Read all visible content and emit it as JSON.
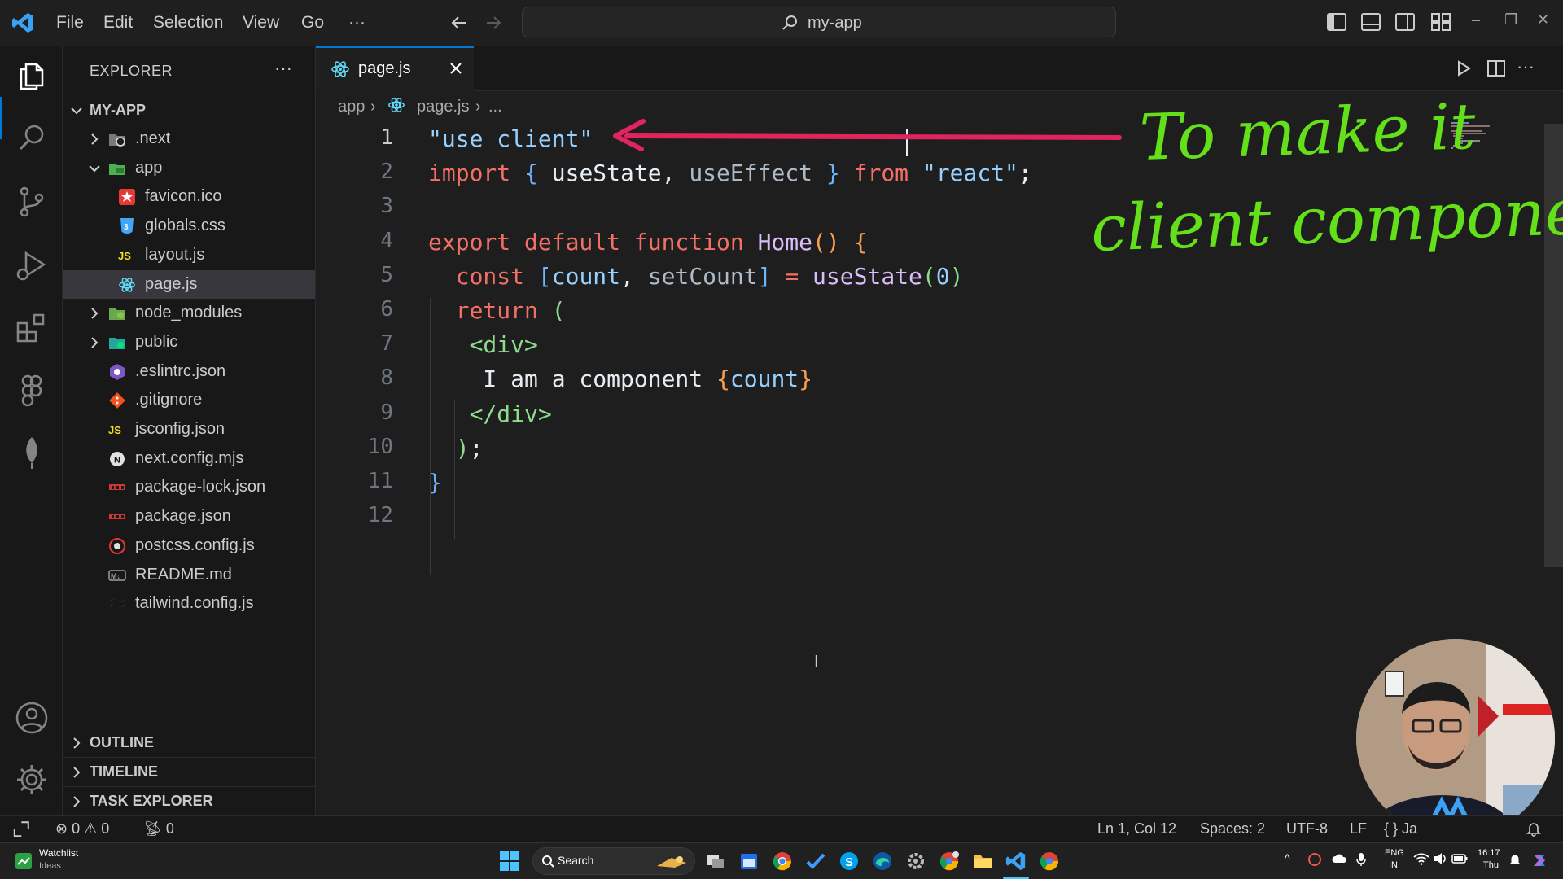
{
  "titlebar": {
    "menu": [
      "File",
      "Edit",
      "Selection",
      "View",
      "Go",
      "···"
    ],
    "search_text": "my-app",
    "window_controls": [
      "–",
      "❐",
      "✕"
    ]
  },
  "activitybar": {
    "icons": [
      "explorer-icon",
      "search-icon",
      "source-control-icon",
      "run-debug-icon",
      "extensions-icon",
      "git-graph-icon",
      "mongodb-leaf-icon",
      "accounts-icon",
      "settings-gear-icon"
    ]
  },
  "sidebar": {
    "title": "EXPLORER",
    "more": "···",
    "root": "MY-APP",
    "tree": [
      {
        "name": ".next",
        "depth": 1,
        "folder": true,
        "open": false,
        "icon": "next-folder-icon"
      },
      {
        "name": "app",
        "depth": 1,
        "folder": true,
        "open": true,
        "icon": "app-folder-icon"
      },
      {
        "name": "favicon.ico",
        "depth": 2,
        "icon": "favicon-icon"
      },
      {
        "name": "globals.css",
        "depth": 2,
        "icon": "css-file-icon"
      },
      {
        "name": "layout.js",
        "depth": 2,
        "icon": "js-file-icon"
      },
      {
        "name": "page.js",
        "depth": 2,
        "icon": "react-file-icon",
        "selected": true
      },
      {
        "name": "node_modules",
        "depth": 1,
        "folder": true,
        "open": false,
        "icon": "node-folder-icon"
      },
      {
        "name": "public",
        "depth": 1,
        "folder": true,
        "open": false,
        "icon": "public-folder-icon"
      },
      {
        "name": ".eslintrc.json",
        "depth": 1,
        "icon": "eslint-file-icon"
      },
      {
        "name": ".gitignore",
        "depth": 1,
        "icon": "git-file-icon"
      },
      {
        "name": "jsconfig.json",
        "depth": 1,
        "icon": "js-file-icon"
      },
      {
        "name": "next.config.mjs",
        "depth": 1,
        "icon": "next-file-icon"
      },
      {
        "name": "package-lock.json",
        "depth": 1,
        "icon": "npm-file-icon"
      },
      {
        "name": "package.json",
        "depth": 1,
        "icon": "npm-file-icon"
      },
      {
        "name": "postcss.config.js",
        "depth": 1,
        "icon": "postcss-file-icon"
      },
      {
        "name": "README.md",
        "depth": 1,
        "icon": "markdown-file-icon"
      },
      {
        "name": "tailwind.config.js",
        "depth": 1,
        "icon": "tailwind-file-icon"
      }
    ],
    "sections": [
      "OUTLINE",
      "TIMELINE",
      "TASK EXPLORER"
    ]
  },
  "editor": {
    "tab_label": "page.js",
    "breadcrumb": [
      "app",
      "page.js",
      "..."
    ],
    "lines": [
      [
        [
          "str",
          "\"use client\""
        ]
      ],
      [
        [
          "kw",
          "import "
        ],
        [
          "br2",
          "{ "
        ],
        [
          "plain",
          "useState"
        ],
        [
          "plain",
          ", "
        ],
        [
          "dim",
          "useEffect"
        ],
        [
          "br2",
          " }"
        ],
        [
          "kw",
          " from "
        ],
        [
          "str",
          "\"react\""
        ],
        [
          "plain",
          ";"
        ]
      ],
      [],
      [
        [
          "kw",
          "export default function "
        ],
        [
          "fn",
          "Home"
        ],
        [
          "br1",
          "() "
        ],
        [
          "br1",
          "{"
        ]
      ],
      [
        [
          "plain",
          "  "
        ],
        [
          "kw",
          "const "
        ],
        [
          "br2",
          "["
        ],
        [
          "var",
          "count"
        ],
        [
          "plain",
          ", "
        ],
        [
          "dim",
          "setCount"
        ],
        [
          "br2",
          "]"
        ],
        [
          "kw",
          " = "
        ],
        [
          "fn",
          "useState"
        ],
        [
          "br3",
          "("
        ],
        [
          "var",
          "0"
        ],
        [
          "br3",
          ")"
        ]
      ],
      [
        [
          "plain",
          "  "
        ],
        [
          "kw",
          "return "
        ],
        [
          "br3",
          "("
        ]
      ],
      [
        [
          "plain",
          "   "
        ],
        [
          "tag",
          "<div>"
        ]
      ],
      [
        [
          "plain",
          "    I am a component "
        ],
        [
          "br1",
          "{"
        ],
        [
          "var",
          "count"
        ],
        [
          "br1",
          "}"
        ]
      ],
      [
        [
          "plain",
          "   "
        ],
        [
          "tag",
          "</div>"
        ]
      ],
      [
        [
          "plain",
          "  "
        ],
        [
          "br3",
          ")"
        ],
        [
          "plain",
          ";"
        ]
      ],
      [
        [
          "br2",
          "}"
        ]
      ],
      []
    ],
    "current_line": 1,
    "mouse_cursor": "I"
  },
  "annotation": {
    "line1": "To make it",
    "line2": "client component",
    "color": "#63e01a",
    "arrow_color": "#e0245e"
  },
  "statusbar": {
    "errors": "0",
    "warnings": "0",
    "ports": "0",
    "position": "Ln 1, Col 12",
    "spaces": "Spaces: 2",
    "encoding": "UTF-8",
    "eol": "LF",
    "lang": "{ } Ja",
    "bell": "bell-icon"
  },
  "taskbar": {
    "widget_title": "Watchlist",
    "widget_sub": "Ideas",
    "search": "Search",
    "lang": "ENG",
    "region": "IN",
    "time": "16:17",
    "day": "Thu",
    "apps": [
      "windows-start-icon",
      "task-view-icon",
      "calendar-icon",
      "chrome-icon",
      "todo-icon",
      "skype-icon",
      "edge-icon",
      "settings-icon",
      "chrome-profile-icon",
      "file-explorer-icon",
      "vscode-icon",
      "chrome-profile2-icon"
    ]
  },
  "colors": {
    "accent": "#0078d4",
    "selection": "#37373d",
    "annotation_green": "#63e01a",
    "annotation_arrow": "#e0245e"
  }
}
